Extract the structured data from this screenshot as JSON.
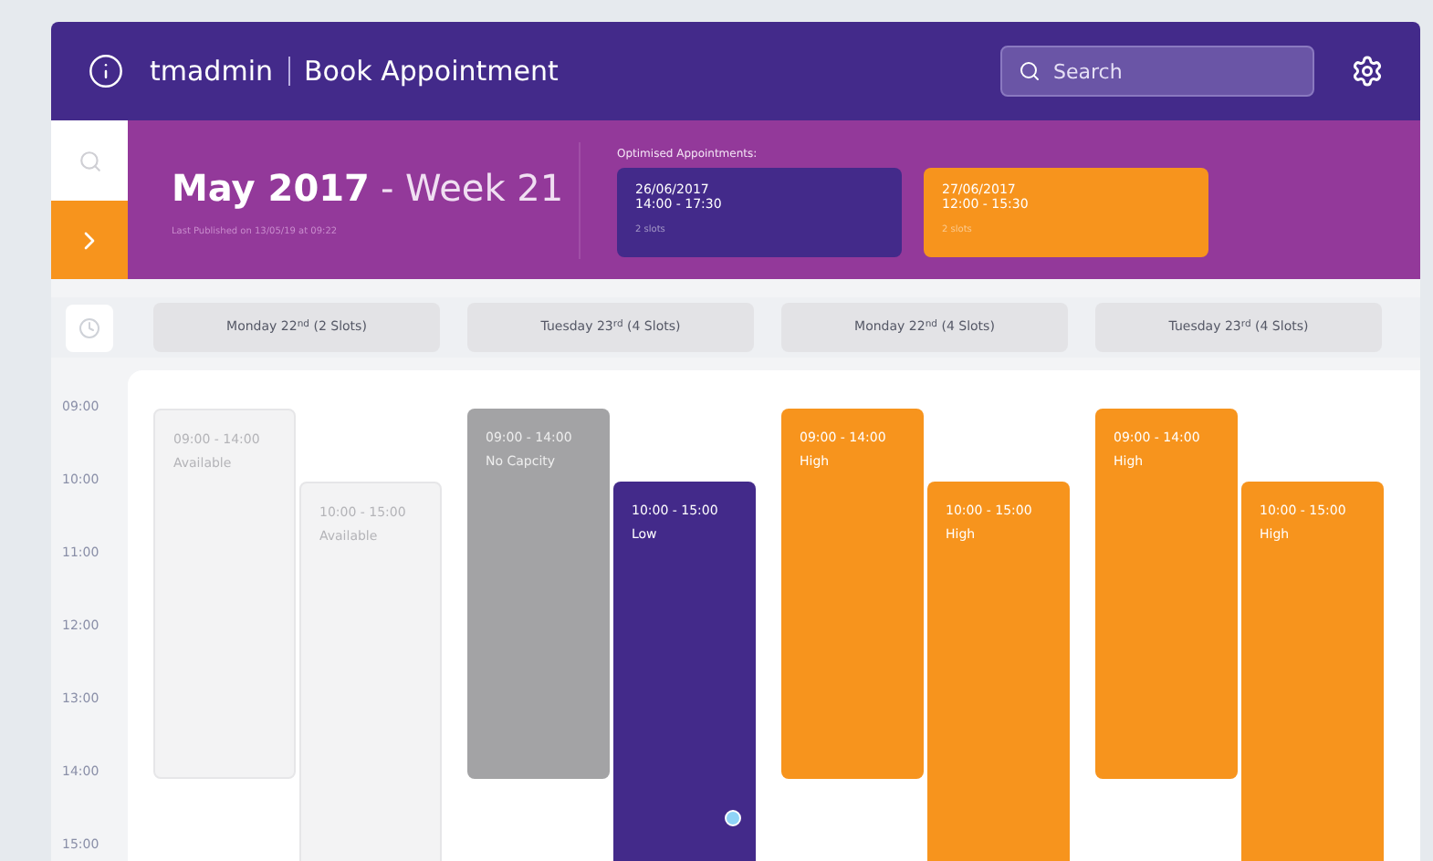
{
  "header": {
    "user": "tmadmin",
    "title": "Book Appointment",
    "search": {
      "placeholder": "Search"
    }
  },
  "banner": {
    "title": "May 2017",
    "week": "- Week 21",
    "published": "Last Published on 13/05/19 at 09:22",
    "optimised_label": "Optimised Appointments:",
    "optimised": [
      {
        "date": "26/06/2017",
        "time": "14:00 - 17:30",
        "note": "2 slots",
        "kind": "low"
      },
      {
        "date": "27/06/2017",
        "time": "12:00 - 15:30",
        "note": "2 slots",
        "kind": "high"
      }
    ]
  },
  "hours": [
    "09:00",
    "10:00",
    "11:00",
    "12:00",
    "13:00",
    "14:00",
    "15:00"
  ],
  "days": [
    {
      "label": "Monday 22$^{nd}$ (2 Slots)",
      "slots": [
        {
          "time": "09:00 - 14:00",
          "status": "Available",
          "kind": "available",
          "selected": false
        },
        {
          "time": "10:00 - 15:00",
          "status": "Available",
          "kind": "available",
          "selected": false
        }
      ]
    },
    {
      "label": "Tuesday 23$^{rd}$ (4 Slots)",
      "slots": [
        {
          "time": "09:00 - 14:00",
          "status": "No Capcity",
          "kind": "none",
          "selected": false
        },
        {
          "time": "10:00 - 15:00",
          "status": "Low",
          "kind": "low",
          "selected": true
        }
      ]
    },
    {
      "label": "Monday 22$^{nd}$ (4 Slots)",
      "slots": [
        {
          "time": "09:00 - 14:00",
          "status": "High",
          "kind": "high",
          "selected": false
        },
        {
          "time": "10:00 - 15:00",
          "status": "High",
          "kind": "high",
          "selected": false
        }
      ]
    },
    {
      "label": "Tuesday 23$^{rd}$ (4 Slots)",
      "slots": [
        {
          "time": "09:00 - 14:00",
          "status": "High",
          "kind": "high",
          "selected": false
        },
        {
          "time": "10:00 - 15:00",
          "status": "High",
          "kind": "high",
          "selected": false
        }
      ]
    }
  ]
}
